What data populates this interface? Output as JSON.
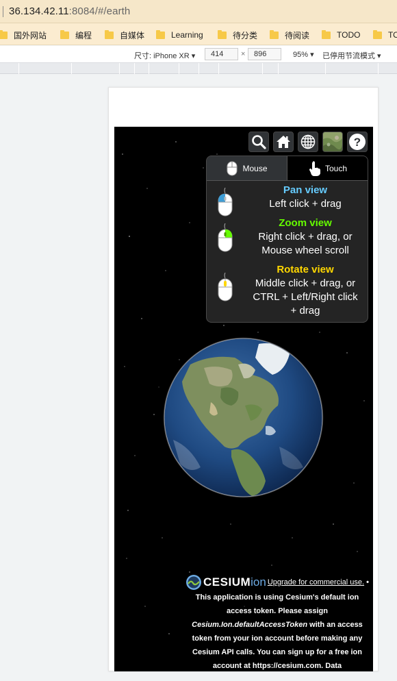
{
  "browser": {
    "url_host": "36.134.42.11",
    "url_rest": ":8084/#/earth",
    "bookmarks": [
      "国外网站",
      "编程",
      "自媒体",
      "Learning",
      "待分类",
      "待阅读",
      "TODO",
      "TO"
    ],
    "device_label": "尺寸: iPhone XR",
    "width": "414",
    "height": "896",
    "times": "×",
    "zoom": "95%",
    "throttle": "已停用节流模式"
  },
  "toolbar": {
    "buttons": [
      "search-icon",
      "home-icon",
      "globe-icon",
      "imagery-icon",
      "help-icon"
    ]
  },
  "navigation_help": {
    "tabs": [
      {
        "label": "Mouse"
      },
      {
        "label": "Touch"
      }
    ],
    "items": [
      {
        "title": "Pan view",
        "lines": [
          "Left click + drag"
        ],
        "color": "#66ccff"
      },
      {
        "title": "Zoom view",
        "lines": [
          "Right click + drag, or",
          "Mouse wheel scroll"
        ],
        "color": "#65fd00"
      },
      {
        "title": "Rotate view",
        "lines": [
          "Middle click + drag, or",
          "CTRL + Left/Right click",
          "+ drag"
        ],
        "color": "#ffd700"
      }
    ]
  },
  "credits": {
    "logo_text": "CESIUM",
    "logo_suffix": "ion",
    "link_text": "Upgrade for commercial use.",
    "message_1": " • This application is using Cesium's default ion access token. Please assign ",
    "token_name": "Cesium.Ion.defaultAccessToken",
    "message_2": " with an access token from your ion account before making any Cesium API calls. You can sign up for a free ion account at https://cesium.com. Data"
  }
}
